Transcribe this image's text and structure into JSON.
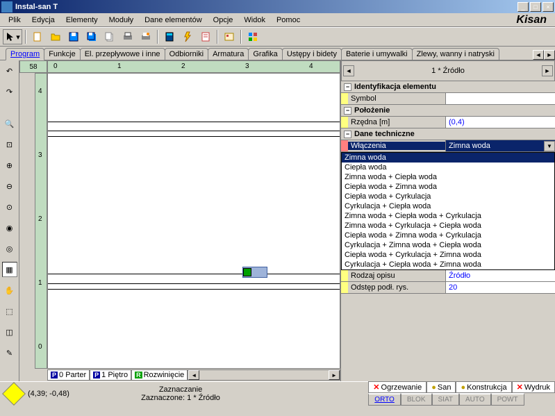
{
  "window": {
    "title": "Instal-san T"
  },
  "menu": {
    "items": [
      "Plik",
      "Edycja",
      "Elementy",
      "Moduły",
      "Dane elementów",
      "Opcje",
      "Widok",
      "Pomoc"
    ]
  },
  "logo": "Kisan",
  "tabs": {
    "items": [
      "Program",
      "Funkcje",
      "El. przepływowe i inne",
      "Odbiorniki",
      "Armatura",
      "Grafika",
      "Ustępy i bidety",
      "Baterie i umywalki",
      "Zlewy, wanny i natryski"
    ],
    "active": 0
  },
  "ruler": {
    "corner": "58",
    "h": [
      "0",
      "1",
      "2",
      "3",
      "4"
    ],
    "v": [
      "4",
      "3",
      "2",
      "1",
      "0"
    ]
  },
  "bottom_tabs": {
    "items": [
      {
        "badge": "P",
        "text": "0 Parter"
      },
      {
        "badge": "P",
        "text": "1 Piętro"
      },
      {
        "badge": "R",
        "text": "Rozwinięcie",
        "g": true
      }
    ]
  },
  "props": {
    "header": "1 * Źródło",
    "sections": [
      {
        "title": "Identyfikacja elementu",
        "rows": [
          {
            "label": "Symbol",
            "value": "",
            "m": "y"
          }
        ]
      },
      {
        "title": "Położenie",
        "rows": [
          {
            "label": "Rzędna [m]",
            "value": "(0,4)",
            "m": "y"
          }
        ]
      },
      {
        "title": "Dane techniczne",
        "rows": [
          {
            "label": "Włączenia",
            "value": "Zimna woda",
            "m": "r",
            "dd": true
          }
        ]
      },
      {
        "title": "_dropdown"
      },
      {
        "rows": [
          {
            "label": "Rodzaj opisu",
            "value": "Źródło",
            "m": "y"
          },
          {
            "label": "Odstęp podł. rys.",
            "value": "20",
            "m": "y"
          }
        ]
      }
    ],
    "dropdown": [
      "Zimna woda",
      "Ciepła woda",
      "Zimna woda + Ciepła woda",
      "Ciepła woda + Zimna woda",
      "Ciepła woda + Cyrkulacja",
      "Cyrkulacja + Ciepła woda",
      "Zimna woda + Ciepła woda + Cyrkulacja",
      "Zimna woda + Cyrkulacja + Ciepła woda",
      "Ciepła woda + Zimna woda + Cyrkulacja",
      "Cyrkulacja + Zimna woda + Ciepła woda",
      "Ciepła woda + Cyrkulacja + Zimna woda",
      "Cyrkulacja + Ciepła woda + Zimna woda"
    ]
  },
  "status": {
    "coords": "(4,39; -0,48)",
    "mode_title": "Zaznaczanie",
    "selection": "Zaznaczone: 1 * Źródło",
    "tabs": [
      "Ogrzewanie",
      "San",
      "Konstrukcja",
      "Wydruk"
    ],
    "modes": [
      "ORTO",
      "BLOK",
      "SIAT",
      "AUTO",
      "POWT"
    ]
  }
}
